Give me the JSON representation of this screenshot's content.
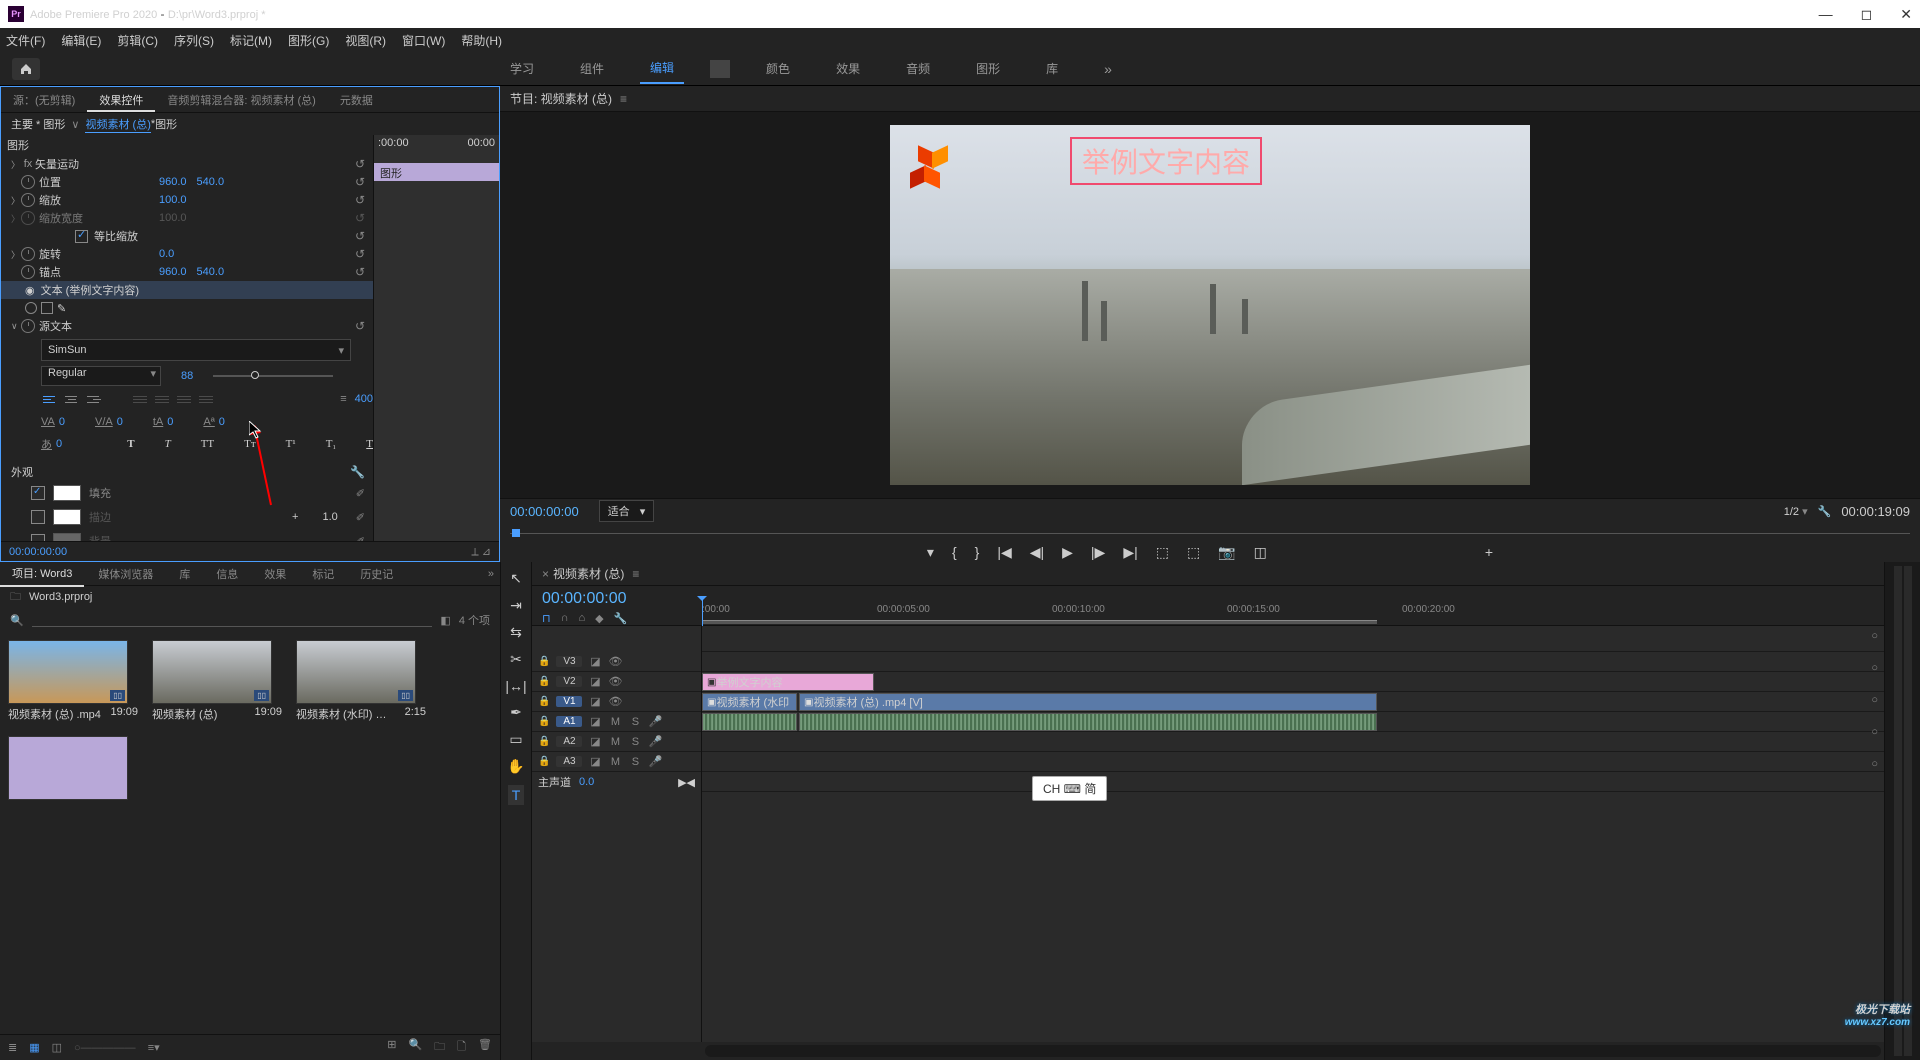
{
  "titlebar": {
    "app": "Adobe Premiere Pro 2020",
    "project_path": "D:\\pr\\Word3.prproj *",
    "logo_text": "Pr"
  },
  "menu": [
    "文件(F)",
    "编辑(E)",
    "剪辑(C)",
    "序列(S)",
    "标记(M)",
    "图形(G)",
    "视图(R)",
    "窗口(W)",
    "帮助(H)"
  ],
  "workspaces": {
    "items": [
      "学习",
      "组件",
      "编辑",
      "颜色",
      "效果",
      "音频",
      "图形",
      "库"
    ],
    "active_index": 2,
    "more": "»"
  },
  "effect_controls": {
    "tabs": [
      "源：(无剪辑)",
      "效果控件",
      "音频剪辑混合器: 视频素材 (总)",
      "元数据"
    ],
    "active_tab": 1,
    "master_label": "主要 * 图形",
    "clip_label": "视频素材 (总)",
    "sub_label": "图形",
    "timeline_start": ":00:00",
    "timeline_end": "00:00",
    "timeline_group_tag": "图形",
    "section_graphic": "图形",
    "vector_motion": "矢量运动",
    "props": {
      "position_label": "位置",
      "position_x": "960.0",
      "position_y": "540.0",
      "scale_label": "缩放",
      "scale_val": "100.0",
      "scale_w_label": "缩放宽度",
      "scale_w_val": "100.0",
      "uniform_label": "等比缩放",
      "rotation_label": "旋转",
      "rotation_val": "0.0",
      "anchor_label": "锚点",
      "anchor_x": "960.0",
      "anchor_y": "540.0"
    },
    "text_layer": "文本 (举例文字内容)",
    "source_text": "源文本",
    "font": "SimSun",
    "weight": "Regular",
    "size": "88",
    "line_val": "400",
    "spacing": {
      "va": "0",
      "vb": "0",
      "vc": "0",
      "vd": "0",
      "ve": "0"
    },
    "appearance_label": "外观",
    "fill_label": "填充",
    "stroke_label": "描边",
    "stroke_width": "1.0",
    "bg_label": "背景",
    "footer_tc": "00:00:00:00"
  },
  "program": {
    "tab": "节目: 视频素材 (总)",
    "overlay_text": "举例文字内容",
    "tc_left": "00:00:00:00",
    "fit_label": "适合",
    "resolution": "1/2",
    "tc_right": "00:00:19:09"
  },
  "project": {
    "tabs": [
      "项目: Word3",
      "媒体浏览器",
      "库",
      "信息",
      "效果",
      "标记",
      "历史记"
    ],
    "more": "»",
    "bin": "Word3.prproj",
    "item_count": "4 个项",
    "items": [
      {
        "name": "视频素材 (总) .mp4",
        "dur": "19:09",
        "thumb": "blue"
      },
      {
        "name": "视频素材 (总)",
        "dur": "19:09",
        "thumb": "city"
      },
      {
        "name": "视频素材 (水印) …",
        "dur": "2:15",
        "thumb": "city"
      }
    ]
  },
  "timeline": {
    "tab": "视频素材 (总)",
    "tc": "00:00:00:00",
    "ticks": [
      {
        "pos": 0,
        "label": ":00:00"
      },
      {
        "pos": 175,
        "label": "00:00:05:00"
      },
      {
        "pos": 350,
        "label": "00:00:10:00"
      },
      {
        "pos": 525,
        "label": "00:00:15:00"
      },
      {
        "pos": 700,
        "label": "00:00:20:00"
      }
    ],
    "tracks": {
      "v3": "V3",
      "v2": "V2",
      "v1": "V1",
      "a1": "A1",
      "a2": "A2",
      "a3": "A3",
      "master": "主声道",
      "master_val": "0.0"
    },
    "clips": {
      "graphic": "举例文字内容",
      "v1a": "视频素材 (水印",
      "v1b": "视频素材 (总) .mp4 [V]"
    },
    "toggles": {
      "m": "M",
      "s": "S"
    }
  },
  "ime": "CH ⌨ 简",
  "watermark": {
    "line1": "极光下载站",
    "line2": "www.xz7.com"
  }
}
